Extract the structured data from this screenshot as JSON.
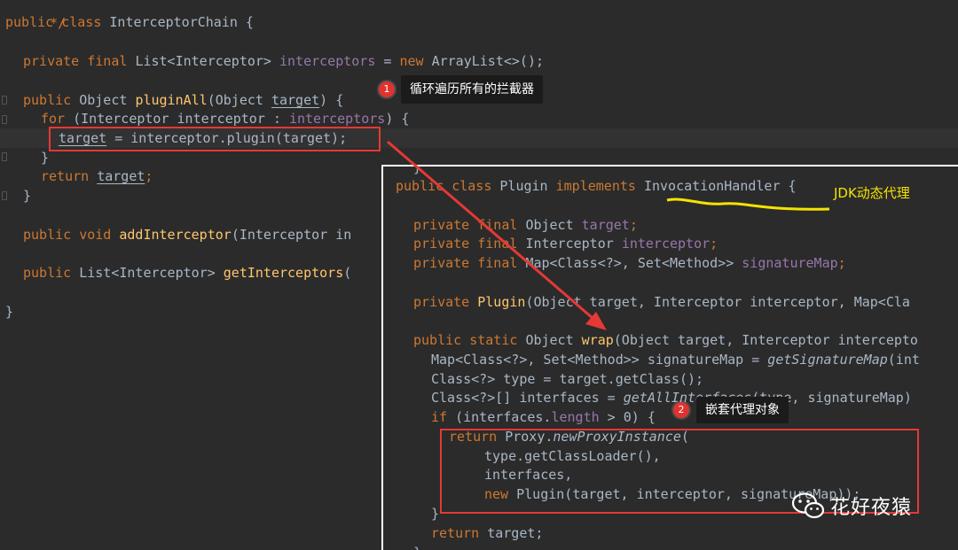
{
  "main_code": {
    "line0": "*/",
    "line1_kw": "public class ",
    "line1_name": "InterceptorChain {",
    "line2_kw": "private final ",
    "line2_type": "List<Interceptor> ",
    "line2_field": "interceptors",
    "line2_rest_a": " = ",
    "line2_rest_kw": "new ",
    "line2_rest_b": "ArrayList<>();",
    "line3_kw": "public ",
    "line3_type": "Object ",
    "line3_fn": "pluginAll",
    "line3_a": "(Object ",
    "line3_param": "target",
    "line3_b": ") {",
    "line4_kw": "for ",
    "line4_a": "(Interceptor interceptor : ",
    "line4_field": "interceptors",
    "line4_b": ") {",
    "line5_var": "target",
    "line5_rest": " = interceptor.plugin(target);",
    "line6": "}",
    "line7_kw": "return ",
    "line7_var": "target",
    "line7_b": ";",
    "line8": "}",
    "line9_kw": "public void ",
    "line9_fn": "addInterceptor",
    "line9_rest": "(Interceptor in",
    "line10_kw": "public ",
    "line10_type": "List<Interceptor> ",
    "line10_fn": "getInterceptors",
    "line10_rest": "(",
    "line11": "}"
  },
  "overlay_code": {
    "l0": "}",
    "l1_kw": "public class ",
    "l1_a": "Plugin ",
    "l1_kw2": "implements ",
    "l1_b": "InvocationHandler {",
    "l2_kw": "private final ",
    "l2_a": "Object ",
    "l2_field": "target",
    "l2_b": ";",
    "l3_kw": "private final ",
    "l3_a": "Interceptor ",
    "l3_field": "interceptor",
    "l3_b": ";",
    "l4_kw": "private final ",
    "l4_a": "Map<Class<?>, Set<Method>> ",
    "l4_field": "signatureMap",
    "l4_b": ";",
    "l5_kw": "private ",
    "l5_fn": "Plugin",
    "l5_a": "(Object target, Interceptor interceptor, Map<Cla",
    "l6_kw": "public static ",
    "l6_a": "Object ",
    "l6_fn": "wrap",
    "l6_b": "(Object target, Interceptor intercepto",
    "l7_a": "Map<Class<?>, Set<Method>> signatureMap = ",
    "l7_it": "getSignatureMap",
    "l7_b": "(int",
    "l8": "Class<?> type = target.getClass();",
    "l9_a": "Class<?>[] interfaces = ",
    "l9_it": "getAllInterfaces",
    "l9_b": "(type, signatureMap)",
    "l10_kw": "if ",
    "l10_a": "(interfaces.",
    "l10_field": "length",
    "l10_b": " > 0) {",
    "l11_kw": "return ",
    "l11_a": "Proxy.",
    "l11_it": "newProxyInstance",
    "l11_b": "(",
    "l12": "type.getClassLoader(),",
    "l13": "interfaces,",
    "l14_kw": "new ",
    "l14_a": "Plugin(target, interceptor, signatureMap));",
    "l15": "}",
    "l16_kw": "return ",
    "l16_a": "target;",
    "l17": "}"
  },
  "annotations": {
    "badge1": "1",
    "note1": "循环遍历所有的拦截器",
    "badge2": "2",
    "note2": "嵌套代理对象",
    "jdk_label": "JDK动态代理"
  },
  "watermark": {
    "text": "花好夜猿",
    "icon": "wechat-icon"
  },
  "colors": {
    "background": "#2b2b2b",
    "keyword": "#cc7832",
    "function": "#ffc66d",
    "field": "#9876aa",
    "text": "#a9b7c6",
    "annotation_red": "#e53935",
    "arrow_red": "#e53935",
    "jdk_yellow": "#f5e300"
  }
}
